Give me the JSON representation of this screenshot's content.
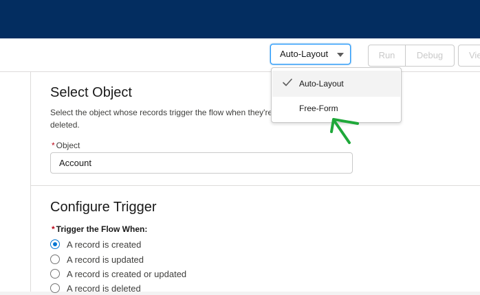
{
  "toolbar": {
    "layout_select_value": "Auto-Layout",
    "run_label": "Run",
    "debug_label": "Debug",
    "view_label": "Vie"
  },
  "layout_dropdown": {
    "options": [
      {
        "label": "Auto-Layout",
        "selected": true
      },
      {
        "label": "Free-Form",
        "selected": false
      }
    ]
  },
  "select_object": {
    "title": "Select Object",
    "help_line1": "Select the object whose records trigger the flow when they're",
    "help_line2": "deleted.",
    "required_mark": "*",
    "field_label": "Object",
    "field_value": "Account"
  },
  "configure_trigger": {
    "title": "Configure Trigger",
    "required_mark": "*",
    "label": "Trigger the Flow When:",
    "options": [
      {
        "label": "A record is created",
        "checked": true
      },
      {
        "label": "A record is updated",
        "checked": false
      },
      {
        "label": "A record is created or updated",
        "checked": false
      },
      {
        "label": "A record is deleted",
        "checked": false
      }
    ]
  },
  "colors": {
    "header_bg": "#032d60",
    "brand_blue": "#0176d3",
    "annotation_green": "#1fa83a"
  }
}
